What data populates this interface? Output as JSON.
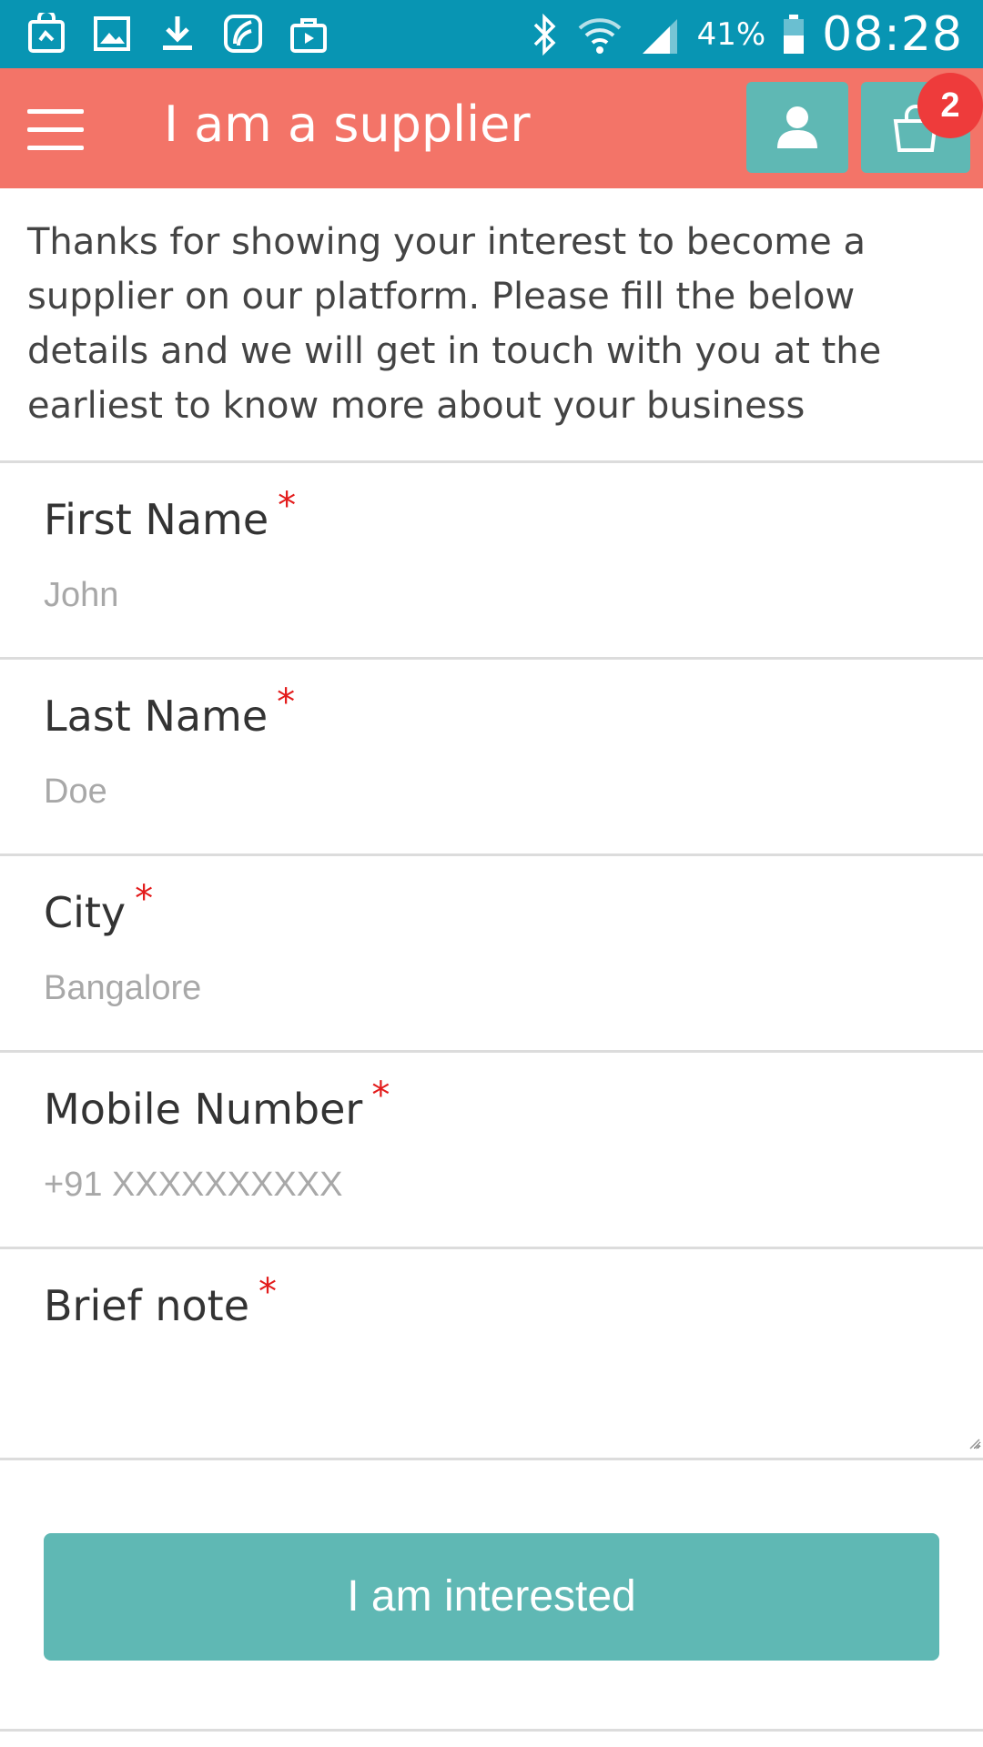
{
  "status_bar": {
    "battery_percent": "41%",
    "time": "08:28",
    "icons_left": [
      "notification-bag-icon",
      "gallery-icon",
      "download-icon",
      "saavn-icon",
      "briefcase-icon"
    ],
    "icons_right": [
      "bluetooth-icon",
      "wifi-icon",
      "signal-icon",
      "battery-icon"
    ]
  },
  "app_bar": {
    "title": "I am a supplier",
    "cart_count": "2",
    "color": "#f37468",
    "button_color": "#5fb8b4"
  },
  "intro": {
    "text": "Thanks for showing your interest to become a supplier on our platform. Please fill the below details and we will get in touch with you at the earliest to know more about your business"
  },
  "form": {
    "required_mark": "*",
    "fields": [
      {
        "label": "First Name",
        "placeholder": "John",
        "value": ""
      },
      {
        "label": "Last Name",
        "placeholder": "Doe",
        "value": ""
      },
      {
        "label": "City",
        "placeholder": "Bangalore",
        "value": ""
      },
      {
        "label": "Mobile Number",
        "placeholder": "+91 XXXXXXXXXX",
        "value": ""
      },
      {
        "label": "Brief note",
        "placeholder": "",
        "value": ""
      }
    ],
    "submit_label": "I am interested"
  }
}
